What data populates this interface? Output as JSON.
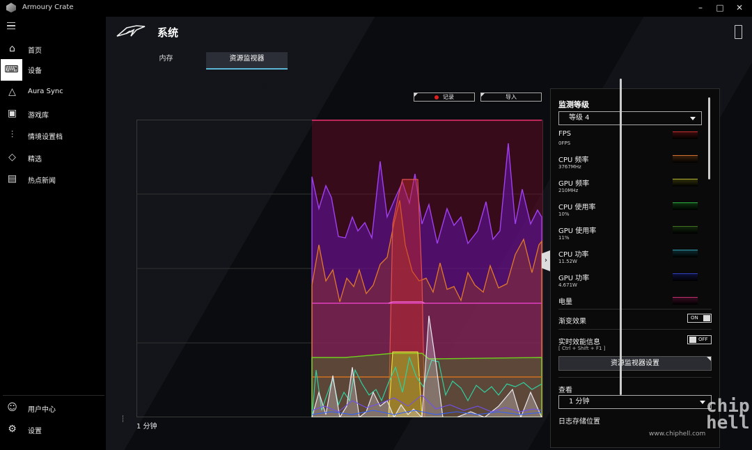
{
  "window": {
    "title": "Armoury Crate"
  },
  "sidebar": {
    "items": [
      {
        "label": "首页",
        "icon": "home-icon"
      },
      {
        "label": "设备",
        "icon": "keyboard-icon",
        "active": true
      },
      {
        "label": "Aura Sync",
        "icon": "aura-icon"
      },
      {
        "label": "游戏库",
        "icon": "gamepad-icon"
      },
      {
        "label": "情境设置档",
        "icon": "sliders-icon"
      },
      {
        "label": "精选",
        "icon": "tag-icon"
      },
      {
        "label": "热点新闻",
        "icon": "news-icon"
      }
    ],
    "bottom": [
      {
        "label": "用户中心",
        "icon": "user-icon"
      },
      {
        "label": "设置",
        "icon": "gear-icon"
      }
    ]
  },
  "header": {
    "title": "系统"
  },
  "tabs": [
    {
      "label": "内存"
    },
    {
      "label": "资源监视器",
      "active": true
    }
  ],
  "toolbar": {
    "record_label": "记录",
    "import_label": "导入"
  },
  "chart": {
    "time_label": "1 分钟"
  },
  "panel": {
    "level_title": "监测等级",
    "level_value": "等级 4",
    "metrics": [
      {
        "name": "FPS",
        "value": "0FPS",
        "color": "#7a1e1e"
      },
      {
        "name": "CPU 频率",
        "value": "3767MHz",
        "color": "#8a4a20"
      },
      {
        "name": "GPU 频率",
        "value": "210MHz",
        "color": "#6c6a20"
      },
      {
        "name": "CPU 使用率",
        "value": "10%",
        "color": "#1e6a2a"
      },
      {
        "name": "GPU 使用率",
        "value": "11%",
        "color": "#2a4a1e"
      },
      {
        "name": "CPU 功率",
        "value": "11.52W",
        "color": "#1e5a66"
      },
      {
        "name": "GPU 功率",
        "value": "4.671W",
        "color": "#1e2a7a"
      },
      {
        "name": "电量",
        "value": "",
        "color": "#7a1e4a"
      }
    ],
    "gradient_label": "渐变效果",
    "gradient_state": "ON",
    "realtime_label": "实时效能信息",
    "realtime_shortcut": "[ Ctrl + Shift + F1 ]",
    "realtime_state": "OFF",
    "settings_button": "资源监视器设置",
    "view_label": "查看",
    "view_value": "1 分钟",
    "log_label": "日志存储位置"
  },
  "watermark": {
    "logo": "chip hell",
    "url": "www.chiphell.com"
  }
}
